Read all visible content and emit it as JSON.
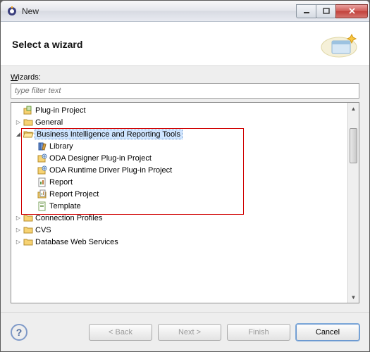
{
  "window": {
    "title": "New"
  },
  "header": {
    "title": "Select a wizard"
  },
  "filter": {
    "label_pre": "W",
    "label_rest": "izards:",
    "placeholder": "type filter text"
  },
  "tree": {
    "top": [
      {
        "label": "Plug-in Project",
        "type": "leaf",
        "icon": "plugin"
      },
      {
        "label": "General",
        "type": "folder",
        "expanded": false
      }
    ],
    "selected": {
      "label": "Business Intelligence and Reporting Tools",
      "children": [
        {
          "label": "Library",
          "icon": "library"
        },
        {
          "label": "ODA Designer Plug-in Project",
          "icon": "oda"
        },
        {
          "label": "ODA Runtime Driver Plug-in Project",
          "icon": "oda"
        },
        {
          "label": "Report",
          "icon": "report"
        },
        {
          "label": "Report Project",
          "icon": "report-proj"
        },
        {
          "label": "Template",
          "icon": "template"
        }
      ]
    },
    "bottom": [
      {
        "label": "Connection Profiles"
      },
      {
        "label": "CVS"
      },
      {
        "label": "Database Web Services"
      }
    ]
  },
  "buttons": {
    "back": "< Back",
    "next": "Next >",
    "finish": "Finish",
    "cancel": "Cancel"
  }
}
